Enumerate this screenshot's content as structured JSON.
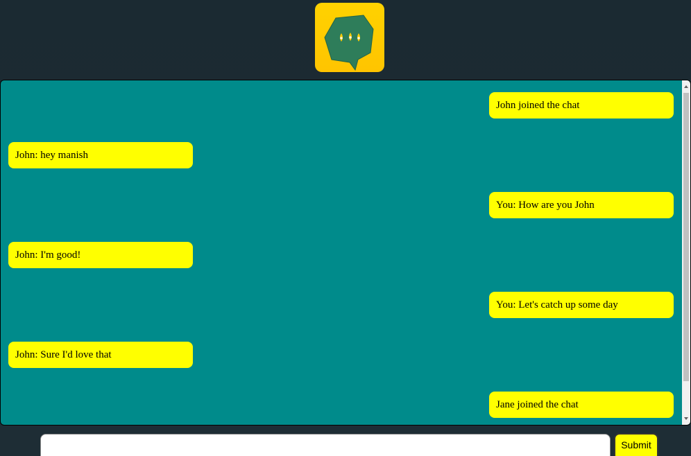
{
  "logo": {
    "icon": "speech-bubble-icon"
  },
  "chat": {
    "messages": [
      {
        "side": "right",
        "text": "John joined the chat"
      },
      {
        "side": "left",
        "text": "John: hey manish"
      },
      {
        "side": "right",
        "text": "You: How are you John"
      },
      {
        "side": "left",
        "text": "John: I'm good!"
      },
      {
        "side": "right",
        "text": "You: Let's catch up some day"
      },
      {
        "side": "left",
        "text": "John: Sure I'd love that"
      },
      {
        "side": "right",
        "text": "Jane joined the chat"
      }
    ]
  },
  "composer": {
    "input_value": "",
    "placeholder": "",
    "submit_label": "Submit"
  },
  "colors": {
    "background": "#1c2b33",
    "chat_panel": "#008b8b",
    "bubble": "#ffff00",
    "logo_bg": "#ffc400",
    "logo_bubble": "#2e7d5a"
  }
}
